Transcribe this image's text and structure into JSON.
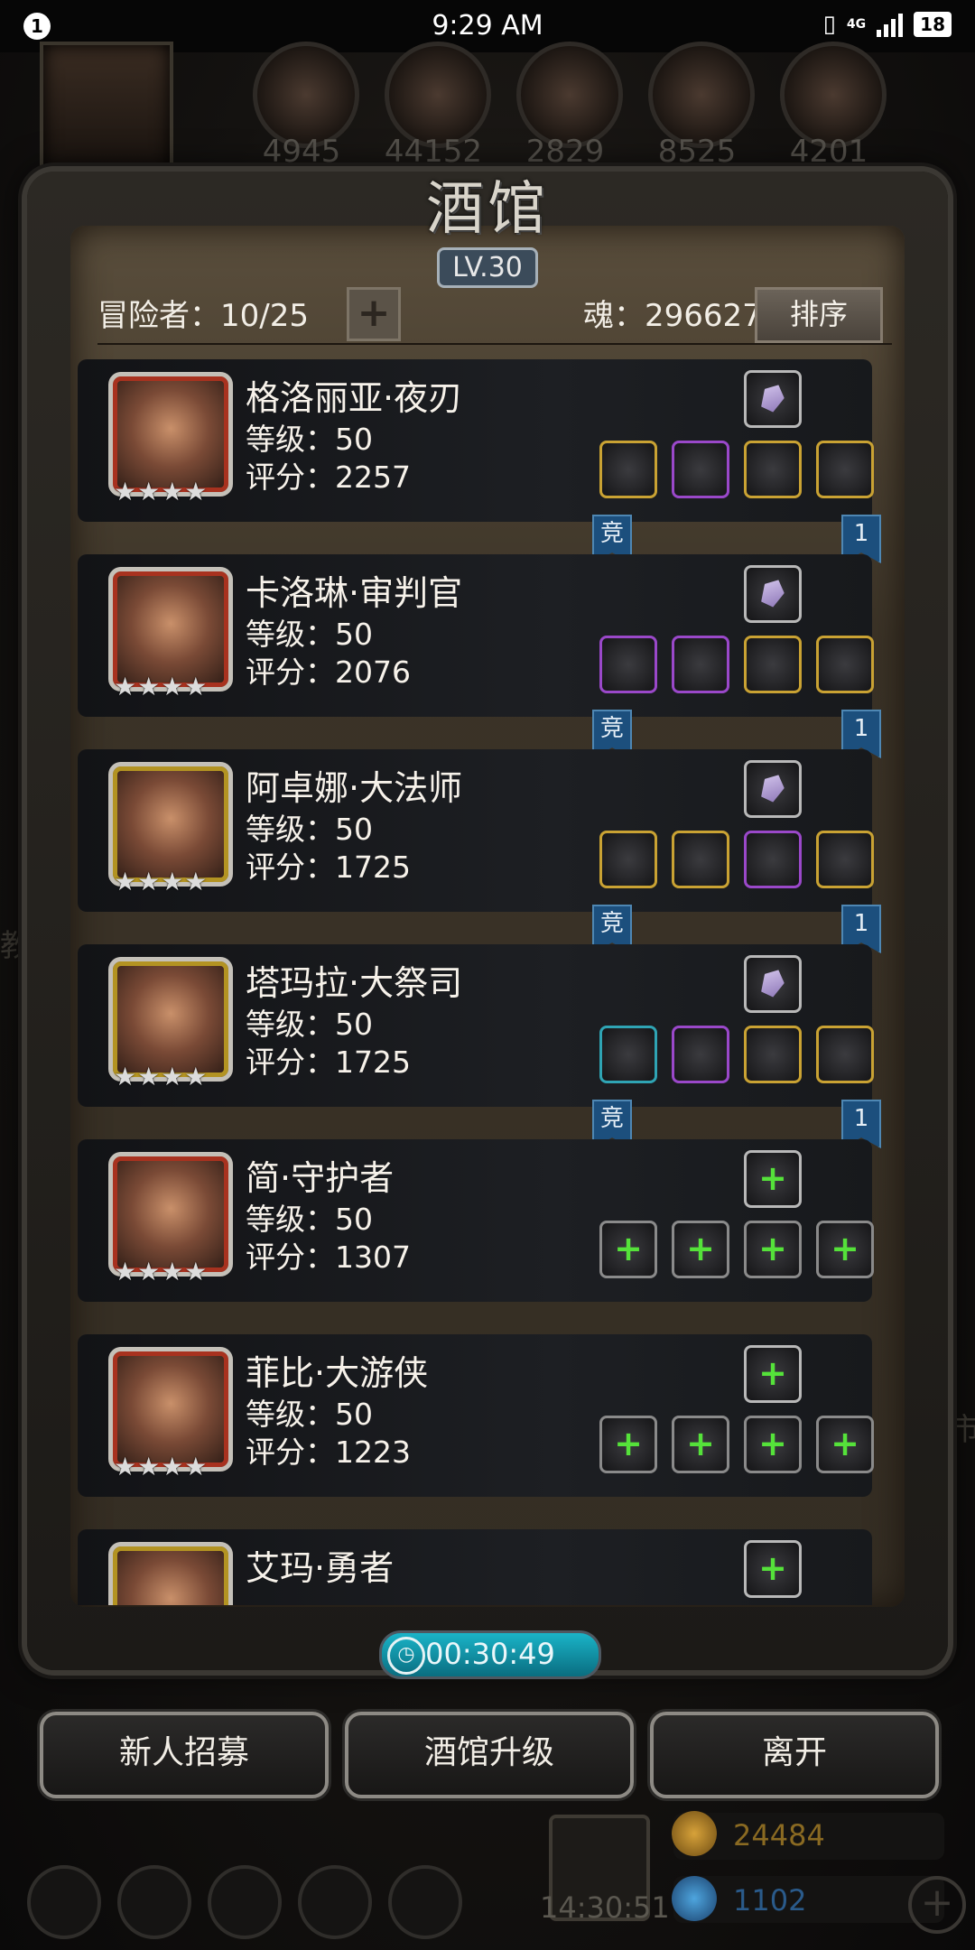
{
  "status_bar": {
    "notification_count": "1",
    "time": "9:29 AM",
    "network": "4G",
    "battery": "18"
  },
  "resources": [
    "4945",
    "44152",
    "2829",
    "8525",
    "4201"
  ],
  "side_text": {
    "left": "教",
    "right": "市"
  },
  "tavern": {
    "title": "酒馆",
    "level": "LV.30",
    "adventurers_label": "冒险者：10/25",
    "soul_label": "魂：296627",
    "sort_button": "排序",
    "heroes": [
      {
        "name": "格洛丽亚·夜刃",
        "level": "等级：50",
        "score": "评分：2257",
        "stars": "★★★★",
        "frame": "red",
        "equipped": true,
        "badge_left": "竞",
        "badge_right": "1",
        "slots": [
          "gold",
          "purple",
          "gold",
          "gold"
        ]
      },
      {
        "name": "卡洛琳·审判官",
        "level": "等级：50",
        "score": "评分：2076",
        "stars": "★★★★",
        "frame": "red",
        "equipped": true,
        "badge_left": "竞",
        "badge_right": "1",
        "slots": [
          "purple",
          "purple",
          "gold",
          "gold"
        ]
      },
      {
        "name": "阿卓娜·大法师",
        "level": "等级：50",
        "score": "评分：1725",
        "stars": "★★★★",
        "frame": "gold",
        "equipped": true,
        "badge_left": "竞",
        "badge_right": "1",
        "slots": [
          "gold",
          "gold",
          "purple",
          "gold"
        ]
      },
      {
        "name": "塔玛拉·大祭司",
        "level": "等级：50",
        "score": "评分：1725",
        "stars": "★★★★",
        "frame": "gold",
        "equipped": true,
        "badge_left": "竞",
        "badge_right": "1",
        "slots": [
          "cyan",
          "purple",
          "gold",
          "gold"
        ]
      },
      {
        "name": "简·守护者",
        "level": "等级：50",
        "score": "评分：1307",
        "stars": "★★★★",
        "frame": "red",
        "equipped": false,
        "slots": [
          "empty",
          "empty",
          "empty",
          "empty"
        ]
      },
      {
        "name": "菲比·大游侠",
        "level": "等级：50",
        "score": "评分：1223",
        "stars": "★★★★",
        "frame": "red",
        "equipped": false,
        "slots": [
          "empty",
          "empty",
          "empty",
          "empty"
        ]
      },
      {
        "name": "艾玛·勇者",
        "level": "",
        "score": "",
        "stars": "",
        "frame": "gold",
        "equipped": false,
        "slots": []
      }
    ],
    "timer": "00:30:49",
    "buttons": {
      "recruit": "新人招募",
      "upgrade": "酒馆升级",
      "leave": "离开"
    }
  },
  "bottom": {
    "time": "14:30:51",
    "gold": "24484",
    "gems": "1102",
    "plus": "+"
  }
}
